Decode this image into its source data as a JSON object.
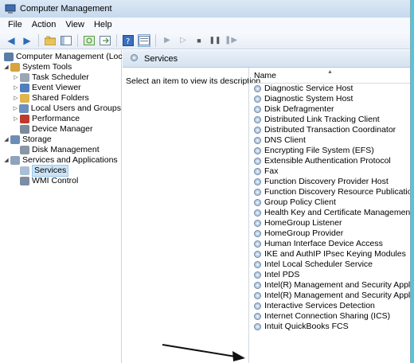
{
  "window": {
    "title": "Computer Management"
  },
  "menu": [
    "File",
    "Action",
    "View",
    "Help"
  ],
  "tree": [
    {
      "label": "Computer Management (Local)",
      "level": 0,
      "expander": "",
      "icon": "computer-management-icon",
      "color": "#5a7ea8"
    },
    {
      "label": "System Tools",
      "level": 1,
      "expander": "◢",
      "icon": "system-tools-icon",
      "color": "#d8a23c"
    },
    {
      "label": "Task Scheduler",
      "level": 2,
      "expander": "▷",
      "icon": "clock-icon",
      "color": "#9aa6b4"
    },
    {
      "label": "Event Viewer",
      "level": 2,
      "expander": "▷",
      "icon": "event-viewer-icon",
      "color": "#4f7fbf"
    },
    {
      "label": "Shared Folders",
      "level": 2,
      "expander": "▷",
      "icon": "shared-folder-icon",
      "color": "#e0b54a"
    },
    {
      "label": "Local Users and Groups",
      "level": 2,
      "expander": "▷",
      "icon": "users-icon",
      "color": "#6a8fc0"
    },
    {
      "label": "Performance",
      "level": 2,
      "expander": "▷",
      "icon": "performance-icon",
      "color": "#c0392b"
    },
    {
      "label": "Device Manager",
      "level": 2,
      "expander": "",
      "icon": "device-manager-icon",
      "color": "#7c8a99"
    },
    {
      "label": "Storage",
      "level": 1,
      "expander": "◢",
      "icon": "storage-icon",
      "color": "#6c8db5"
    },
    {
      "label": "Disk Management",
      "level": 2,
      "expander": "",
      "icon": "disk-icon",
      "color": "#8896a6"
    },
    {
      "label": "Services and Applications",
      "level": 1,
      "expander": "◢",
      "icon": "services-apps-icon",
      "color": "#8fa3bb"
    },
    {
      "label": "Services",
      "level": 2,
      "expander": "",
      "icon": "services-icon",
      "color": "#a9bfd6",
      "selected": true
    },
    {
      "label": "WMI Control",
      "level": 2,
      "expander": "",
      "icon": "wmi-icon",
      "color": "#7d8ea3"
    }
  ],
  "services_panel": {
    "title": "Services",
    "description": "Select an item to view its description.",
    "column_name": "Name",
    "items": [
      "Diagnostic Service Host",
      "Diagnostic System Host",
      "Disk Defragmenter",
      "Distributed Link Tracking Client",
      "Distributed Transaction Coordinator",
      "DNS Client",
      "Encrypting File System (EFS)",
      "Extensible Authentication Protocol",
      "Fax",
      "Function Discovery Provider Host",
      "Function Discovery Resource Publication",
      "Group Policy Client",
      "Health Key and Certificate Management",
      "HomeGroup Listener",
      "HomeGroup Provider",
      "Human Interface Device Access",
      "IKE and AuthIP IPsec Keying Modules",
      "Intel Local Scheduler Service",
      "Intel PDS",
      "Intel(R) Management and Security Applicat...",
      "Intel(R) Management and Security Applicat...",
      "Interactive Services Detection",
      "Internet Connection Sharing (ICS)",
      "Intuit QuickBooks FCS"
    ]
  },
  "colors": {
    "accent_bg": "#4fc6e6",
    "selected": "#cce4f7"
  }
}
